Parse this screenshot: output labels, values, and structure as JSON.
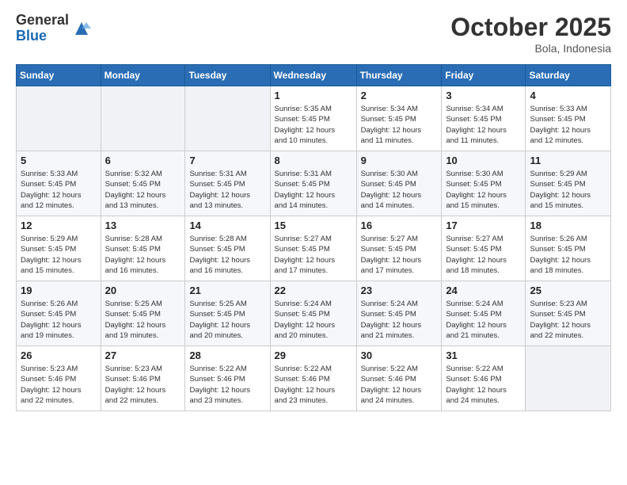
{
  "header": {
    "logo_general": "General",
    "logo_blue": "Blue",
    "month": "October 2025",
    "location": "Bola, Indonesia"
  },
  "weekdays": [
    "Sunday",
    "Monday",
    "Tuesday",
    "Wednesday",
    "Thursday",
    "Friday",
    "Saturday"
  ],
  "weeks": [
    [
      {
        "day": "",
        "info": ""
      },
      {
        "day": "",
        "info": ""
      },
      {
        "day": "",
        "info": ""
      },
      {
        "day": "1",
        "info": "Sunrise: 5:35 AM\nSunset: 5:45 PM\nDaylight: 12 hours\nand 10 minutes."
      },
      {
        "day": "2",
        "info": "Sunrise: 5:34 AM\nSunset: 5:45 PM\nDaylight: 12 hours\nand 11 minutes."
      },
      {
        "day": "3",
        "info": "Sunrise: 5:34 AM\nSunset: 5:45 PM\nDaylight: 12 hours\nand 11 minutes."
      },
      {
        "day": "4",
        "info": "Sunrise: 5:33 AM\nSunset: 5:45 PM\nDaylight: 12 hours\nand 12 minutes."
      }
    ],
    [
      {
        "day": "5",
        "info": "Sunrise: 5:33 AM\nSunset: 5:45 PM\nDaylight: 12 hours\nand 12 minutes."
      },
      {
        "day": "6",
        "info": "Sunrise: 5:32 AM\nSunset: 5:45 PM\nDaylight: 12 hours\nand 13 minutes."
      },
      {
        "day": "7",
        "info": "Sunrise: 5:31 AM\nSunset: 5:45 PM\nDaylight: 12 hours\nand 13 minutes."
      },
      {
        "day": "8",
        "info": "Sunrise: 5:31 AM\nSunset: 5:45 PM\nDaylight: 12 hours\nand 14 minutes."
      },
      {
        "day": "9",
        "info": "Sunrise: 5:30 AM\nSunset: 5:45 PM\nDaylight: 12 hours\nand 14 minutes."
      },
      {
        "day": "10",
        "info": "Sunrise: 5:30 AM\nSunset: 5:45 PM\nDaylight: 12 hours\nand 15 minutes."
      },
      {
        "day": "11",
        "info": "Sunrise: 5:29 AM\nSunset: 5:45 PM\nDaylight: 12 hours\nand 15 minutes."
      }
    ],
    [
      {
        "day": "12",
        "info": "Sunrise: 5:29 AM\nSunset: 5:45 PM\nDaylight: 12 hours\nand 15 minutes."
      },
      {
        "day": "13",
        "info": "Sunrise: 5:28 AM\nSunset: 5:45 PM\nDaylight: 12 hours\nand 16 minutes."
      },
      {
        "day": "14",
        "info": "Sunrise: 5:28 AM\nSunset: 5:45 PM\nDaylight: 12 hours\nand 16 minutes."
      },
      {
        "day": "15",
        "info": "Sunrise: 5:27 AM\nSunset: 5:45 PM\nDaylight: 12 hours\nand 17 minutes."
      },
      {
        "day": "16",
        "info": "Sunrise: 5:27 AM\nSunset: 5:45 PM\nDaylight: 12 hours\nand 17 minutes."
      },
      {
        "day": "17",
        "info": "Sunrise: 5:27 AM\nSunset: 5:45 PM\nDaylight: 12 hours\nand 18 minutes."
      },
      {
        "day": "18",
        "info": "Sunrise: 5:26 AM\nSunset: 5:45 PM\nDaylight: 12 hours\nand 18 minutes."
      }
    ],
    [
      {
        "day": "19",
        "info": "Sunrise: 5:26 AM\nSunset: 5:45 PM\nDaylight: 12 hours\nand 19 minutes."
      },
      {
        "day": "20",
        "info": "Sunrise: 5:25 AM\nSunset: 5:45 PM\nDaylight: 12 hours\nand 19 minutes."
      },
      {
        "day": "21",
        "info": "Sunrise: 5:25 AM\nSunset: 5:45 PM\nDaylight: 12 hours\nand 20 minutes."
      },
      {
        "day": "22",
        "info": "Sunrise: 5:24 AM\nSunset: 5:45 PM\nDaylight: 12 hours\nand 20 minutes."
      },
      {
        "day": "23",
        "info": "Sunrise: 5:24 AM\nSunset: 5:45 PM\nDaylight: 12 hours\nand 21 minutes."
      },
      {
        "day": "24",
        "info": "Sunrise: 5:24 AM\nSunset: 5:45 PM\nDaylight: 12 hours\nand 21 minutes."
      },
      {
        "day": "25",
        "info": "Sunrise: 5:23 AM\nSunset: 5:45 PM\nDaylight: 12 hours\nand 22 minutes."
      }
    ],
    [
      {
        "day": "26",
        "info": "Sunrise: 5:23 AM\nSunset: 5:46 PM\nDaylight: 12 hours\nand 22 minutes."
      },
      {
        "day": "27",
        "info": "Sunrise: 5:23 AM\nSunset: 5:46 PM\nDaylight: 12 hours\nand 22 minutes."
      },
      {
        "day": "28",
        "info": "Sunrise: 5:22 AM\nSunset: 5:46 PM\nDaylight: 12 hours\nand 23 minutes."
      },
      {
        "day": "29",
        "info": "Sunrise: 5:22 AM\nSunset: 5:46 PM\nDaylight: 12 hours\nand 23 minutes."
      },
      {
        "day": "30",
        "info": "Sunrise: 5:22 AM\nSunset: 5:46 PM\nDaylight: 12 hours\nand 24 minutes."
      },
      {
        "day": "31",
        "info": "Sunrise: 5:22 AM\nSunset: 5:46 PM\nDaylight: 12 hours\nand 24 minutes."
      },
      {
        "day": "",
        "info": ""
      }
    ]
  ]
}
